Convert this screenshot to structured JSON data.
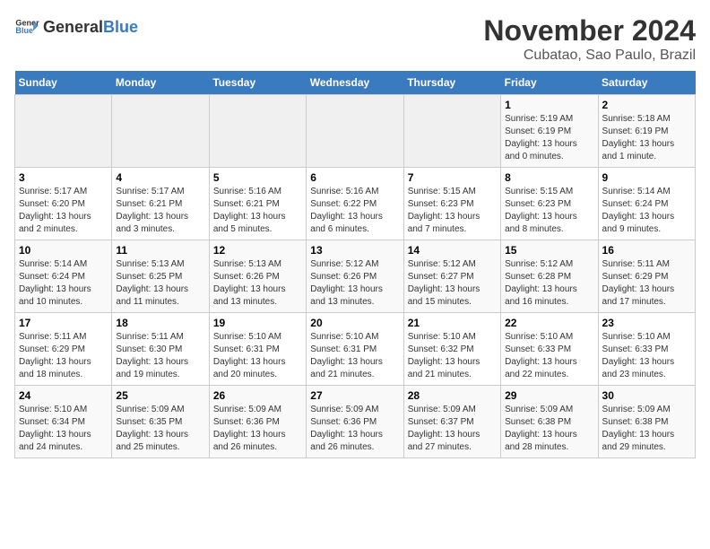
{
  "logo": {
    "text_general": "General",
    "text_blue": "Blue"
  },
  "title": "November 2024",
  "location": "Cubatao, Sao Paulo, Brazil",
  "weekdays": [
    "Sunday",
    "Monday",
    "Tuesday",
    "Wednesday",
    "Thursday",
    "Friday",
    "Saturday"
  ],
  "weeks": [
    [
      {
        "day": "",
        "info": ""
      },
      {
        "day": "",
        "info": ""
      },
      {
        "day": "",
        "info": ""
      },
      {
        "day": "",
        "info": ""
      },
      {
        "day": "",
        "info": ""
      },
      {
        "day": "1",
        "info": "Sunrise: 5:19 AM\nSunset: 6:19 PM\nDaylight: 13 hours and 0 minutes."
      },
      {
        "day": "2",
        "info": "Sunrise: 5:18 AM\nSunset: 6:19 PM\nDaylight: 13 hours and 1 minute."
      }
    ],
    [
      {
        "day": "3",
        "info": "Sunrise: 5:17 AM\nSunset: 6:20 PM\nDaylight: 13 hours and 2 minutes."
      },
      {
        "day": "4",
        "info": "Sunrise: 5:17 AM\nSunset: 6:21 PM\nDaylight: 13 hours and 3 minutes."
      },
      {
        "day": "5",
        "info": "Sunrise: 5:16 AM\nSunset: 6:21 PM\nDaylight: 13 hours and 5 minutes."
      },
      {
        "day": "6",
        "info": "Sunrise: 5:16 AM\nSunset: 6:22 PM\nDaylight: 13 hours and 6 minutes."
      },
      {
        "day": "7",
        "info": "Sunrise: 5:15 AM\nSunset: 6:23 PM\nDaylight: 13 hours and 7 minutes."
      },
      {
        "day": "8",
        "info": "Sunrise: 5:15 AM\nSunset: 6:23 PM\nDaylight: 13 hours and 8 minutes."
      },
      {
        "day": "9",
        "info": "Sunrise: 5:14 AM\nSunset: 6:24 PM\nDaylight: 13 hours and 9 minutes."
      }
    ],
    [
      {
        "day": "10",
        "info": "Sunrise: 5:14 AM\nSunset: 6:24 PM\nDaylight: 13 hours and 10 minutes."
      },
      {
        "day": "11",
        "info": "Sunrise: 5:13 AM\nSunset: 6:25 PM\nDaylight: 13 hours and 11 minutes."
      },
      {
        "day": "12",
        "info": "Sunrise: 5:13 AM\nSunset: 6:26 PM\nDaylight: 13 hours and 13 minutes."
      },
      {
        "day": "13",
        "info": "Sunrise: 5:12 AM\nSunset: 6:26 PM\nDaylight: 13 hours and 13 minutes."
      },
      {
        "day": "14",
        "info": "Sunrise: 5:12 AM\nSunset: 6:27 PM\nDaylight: 13 hours and 15 minutes."
      },
      {
        "day": "15",
        "info": "Sunrise: 5:12 AM\nSunset: 6:28 PM\nDaylight: 13 hours and 16 minutes."
      },
      {
        "day": "16",
        "info": "Sunrise: 5:11 AM\nSunset: 6:29 PM\nDaylight: 13 hours and 17 minutes."
      }
    ],
    [
      {
        "day": "17",
        "info": "Sunrise: 5:11 AM\nSunset: 6:29 PM\nDaylight: 13 hours and 18 minutes."
      },
      {
        "day": "18",
        "info": "Sunrise: 5:11 AM\nSunset: 6:30 PM\nDaylight: 13 hours and 19 minutes."
      },
      {
        "day": "19",
        "info": "Sunrise: 5:10 AM\nSunset: 6:31 PM\nDaylight: 13 hours and 20 minutes."
      },
      {
        "day": "20",
        "info": "Sunrise: 5:10 AM\nSunset: 6:31 PM\nDaylight: 13 hours and 21 minutes."
      },
      {
        "day": "21",
        "info": "Sunrise: 5:10 AM\nSunset: 6:32 PM\nDaylight: 13 hours and 21 minutes."
      },
      {
        "day": "22",
        "info": "Sunrise: 5:10 AM\nSunset: 6:33 PM\nDaylight: 13 hours and 22 minutes."
      },
      {
        "day": "23",
        "info": "Sunrise: 5:10 AM\nSunset: 6:33 PM\nDaylight: 13 hours and 23 minutes."
      }
    ],
    [
      {
        "day": "24",
        "info": "Sunrise: 5:10 AM\nSunset: 6:34 PM\nDaylight: 13 hours and 24 minutes."
      },
      {
        "day": "25",
        "info": "Sunrise: 5:09 AM\nSunset: 6:35 PM\nDaylight: 13 hours and 25 minutes."
      },
      {
        "day": "26",
        "info": "Sunrise: 5:09 AM\nSunset: 6:36 PM\nDaylight: 13 hours and 26 minutes."
      },
      {
        "day": "27",
        "info": "Sunrise: 5:09 AM\nSunset: 6:36 PM\nDaylight: 13 hours and 26 minutes."
      },
      {
        "day": "28",
        "info": "Sunrise: 5:09 AM\nSunset: 6:37 PM\nDaylight: 13 hours and 27 minutes."
      },
      {
        "day": "29",
        "info": "Sunrise: 5:09 AM\nSunset: 6:38 PM\nDaylight: 13 hours and 28 minutes."
      },
      {
        "day": "30",
        "info": "Sunrise: 5:09 AM\nSunset: 6:38 PM\nDaylight: 13 hours and 29 minutes."
      }
    ]
  ]
}
